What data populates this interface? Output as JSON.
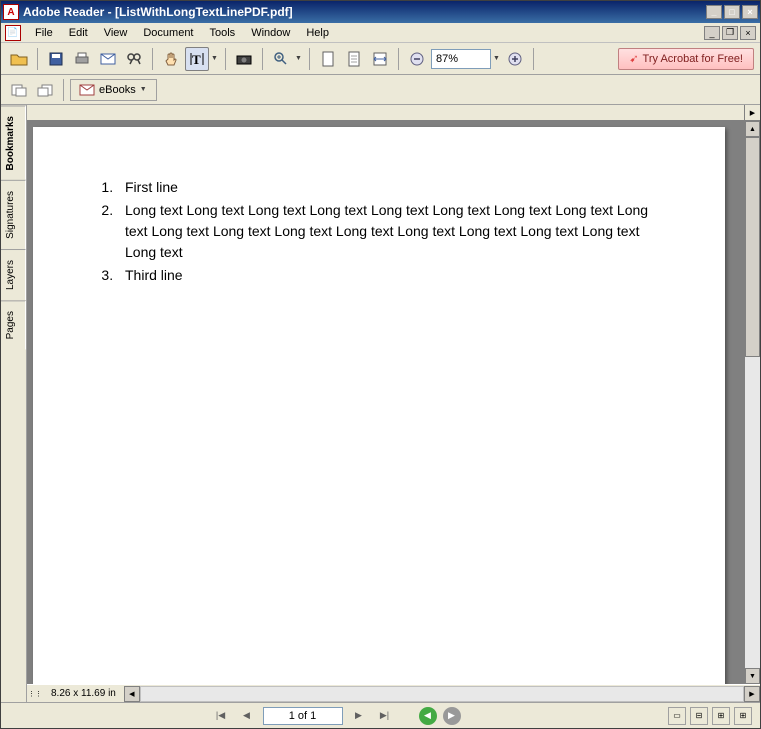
{
  "window": {
    "title": "Adobe Reader - [ListWithLongTextLinePDF.pdf]"
  },
  "menu": {
    "file": "File",
    "edit": "Edit",
    "view": "View",
    "document": "Document",
    "tools": "Tools",
    "window": "Window",
    "help": "Help"
  },
  "toolbar": {
    "zoom_value": "87%",
    "acrobat_label": "Try Acrobat for Free!",
    "ebooks_label": "eBooks"
  },
  "sidebar": {
    "tabs": [
      "Bookmarks",
      "Signatures",
      "Layers",
      "Pages"
    ]
  },
  "document": {
    "list": [
      "First line",
      "Long text Long text Long text Long text Long text Long text Long text Long text Long text Long text Long text Long text Long text Long text Long text Long text Long text Long text",
      "Third line"
    ]
  },
  "status": {
    "dimensions": "8.26 x 11.69 in",
    "page_label": "1 of 1"
  }
}
